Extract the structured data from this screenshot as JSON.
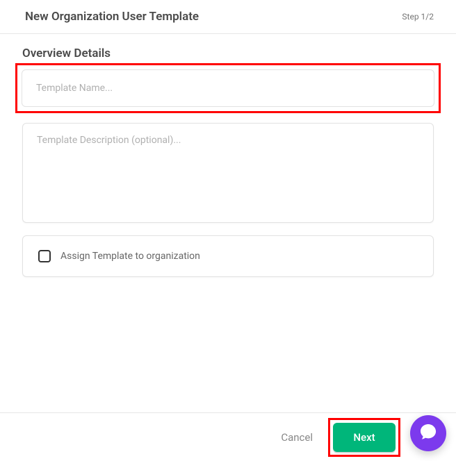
{
  "header": {
    "title": "New Organization User Template",
    "step": "Step 1/2"
  },
  "section": {
    "title": "Overview Details"
  },
  "form": {
    "name_placeholder": "Template Name...",
    "name_value": "",
    "description_placeholder": "Template Description (optional)...",
    "description_value": "",
    "assign_label": "Assign Template to organization"
  },
  "footer": {
    "cancel_label": "Cancel",
    "next_label": "Next"
  },
  "icons": {
    "chat": "chat-icon"
  }
}
